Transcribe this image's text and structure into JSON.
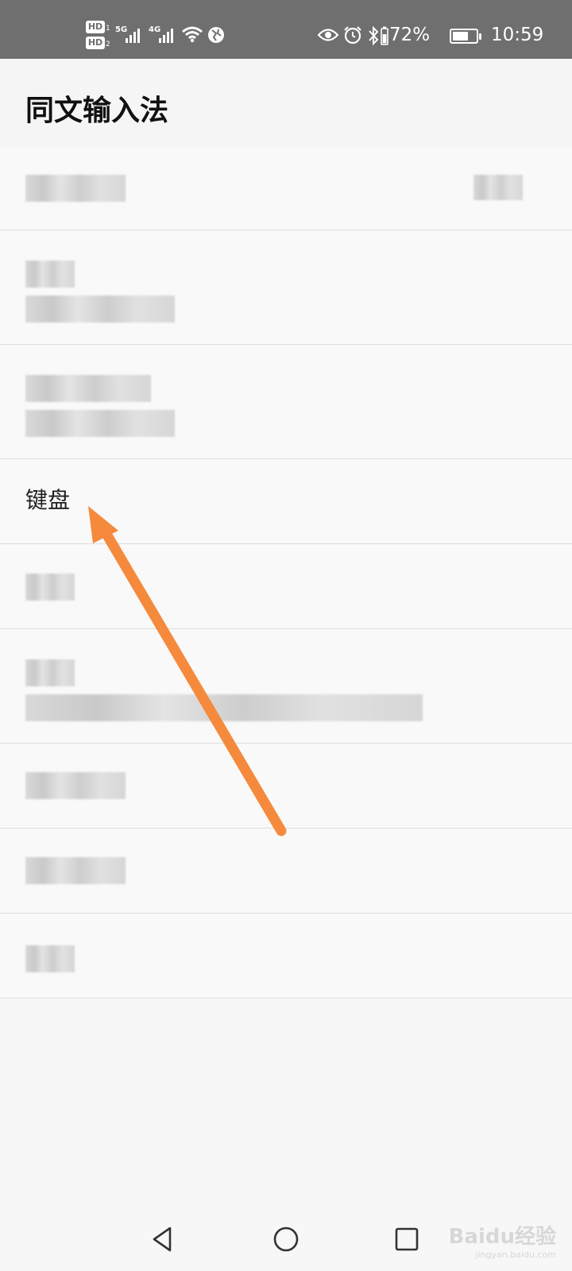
{
  "status_bar": {
    "hd_label": "HD",
    "sim1": "1",
    "sim2": "2",
    "network1": "5G",
    "network2": "4G",
    "battery_percent_text": "72%",
    "battery_level": 0.72,
    "time": "10:59"
  },
  "app_bar": {
    "title": "同文输入法"
  },
  "settings": {
    "keyboard_label": "键盘"
  },
  "colors": {
    "arrow": "#f58a3d",
    "status_bar_bg": "#6f6f6f"
  },
  "navigation": {
    "back": "back-icon",
    "home": "home-icon",
    "recents": "recents-icon"
  },
  "watermark": {
    "text": "Baidu经验",
    "url": "jingyan.baidu.com"
  }
}
